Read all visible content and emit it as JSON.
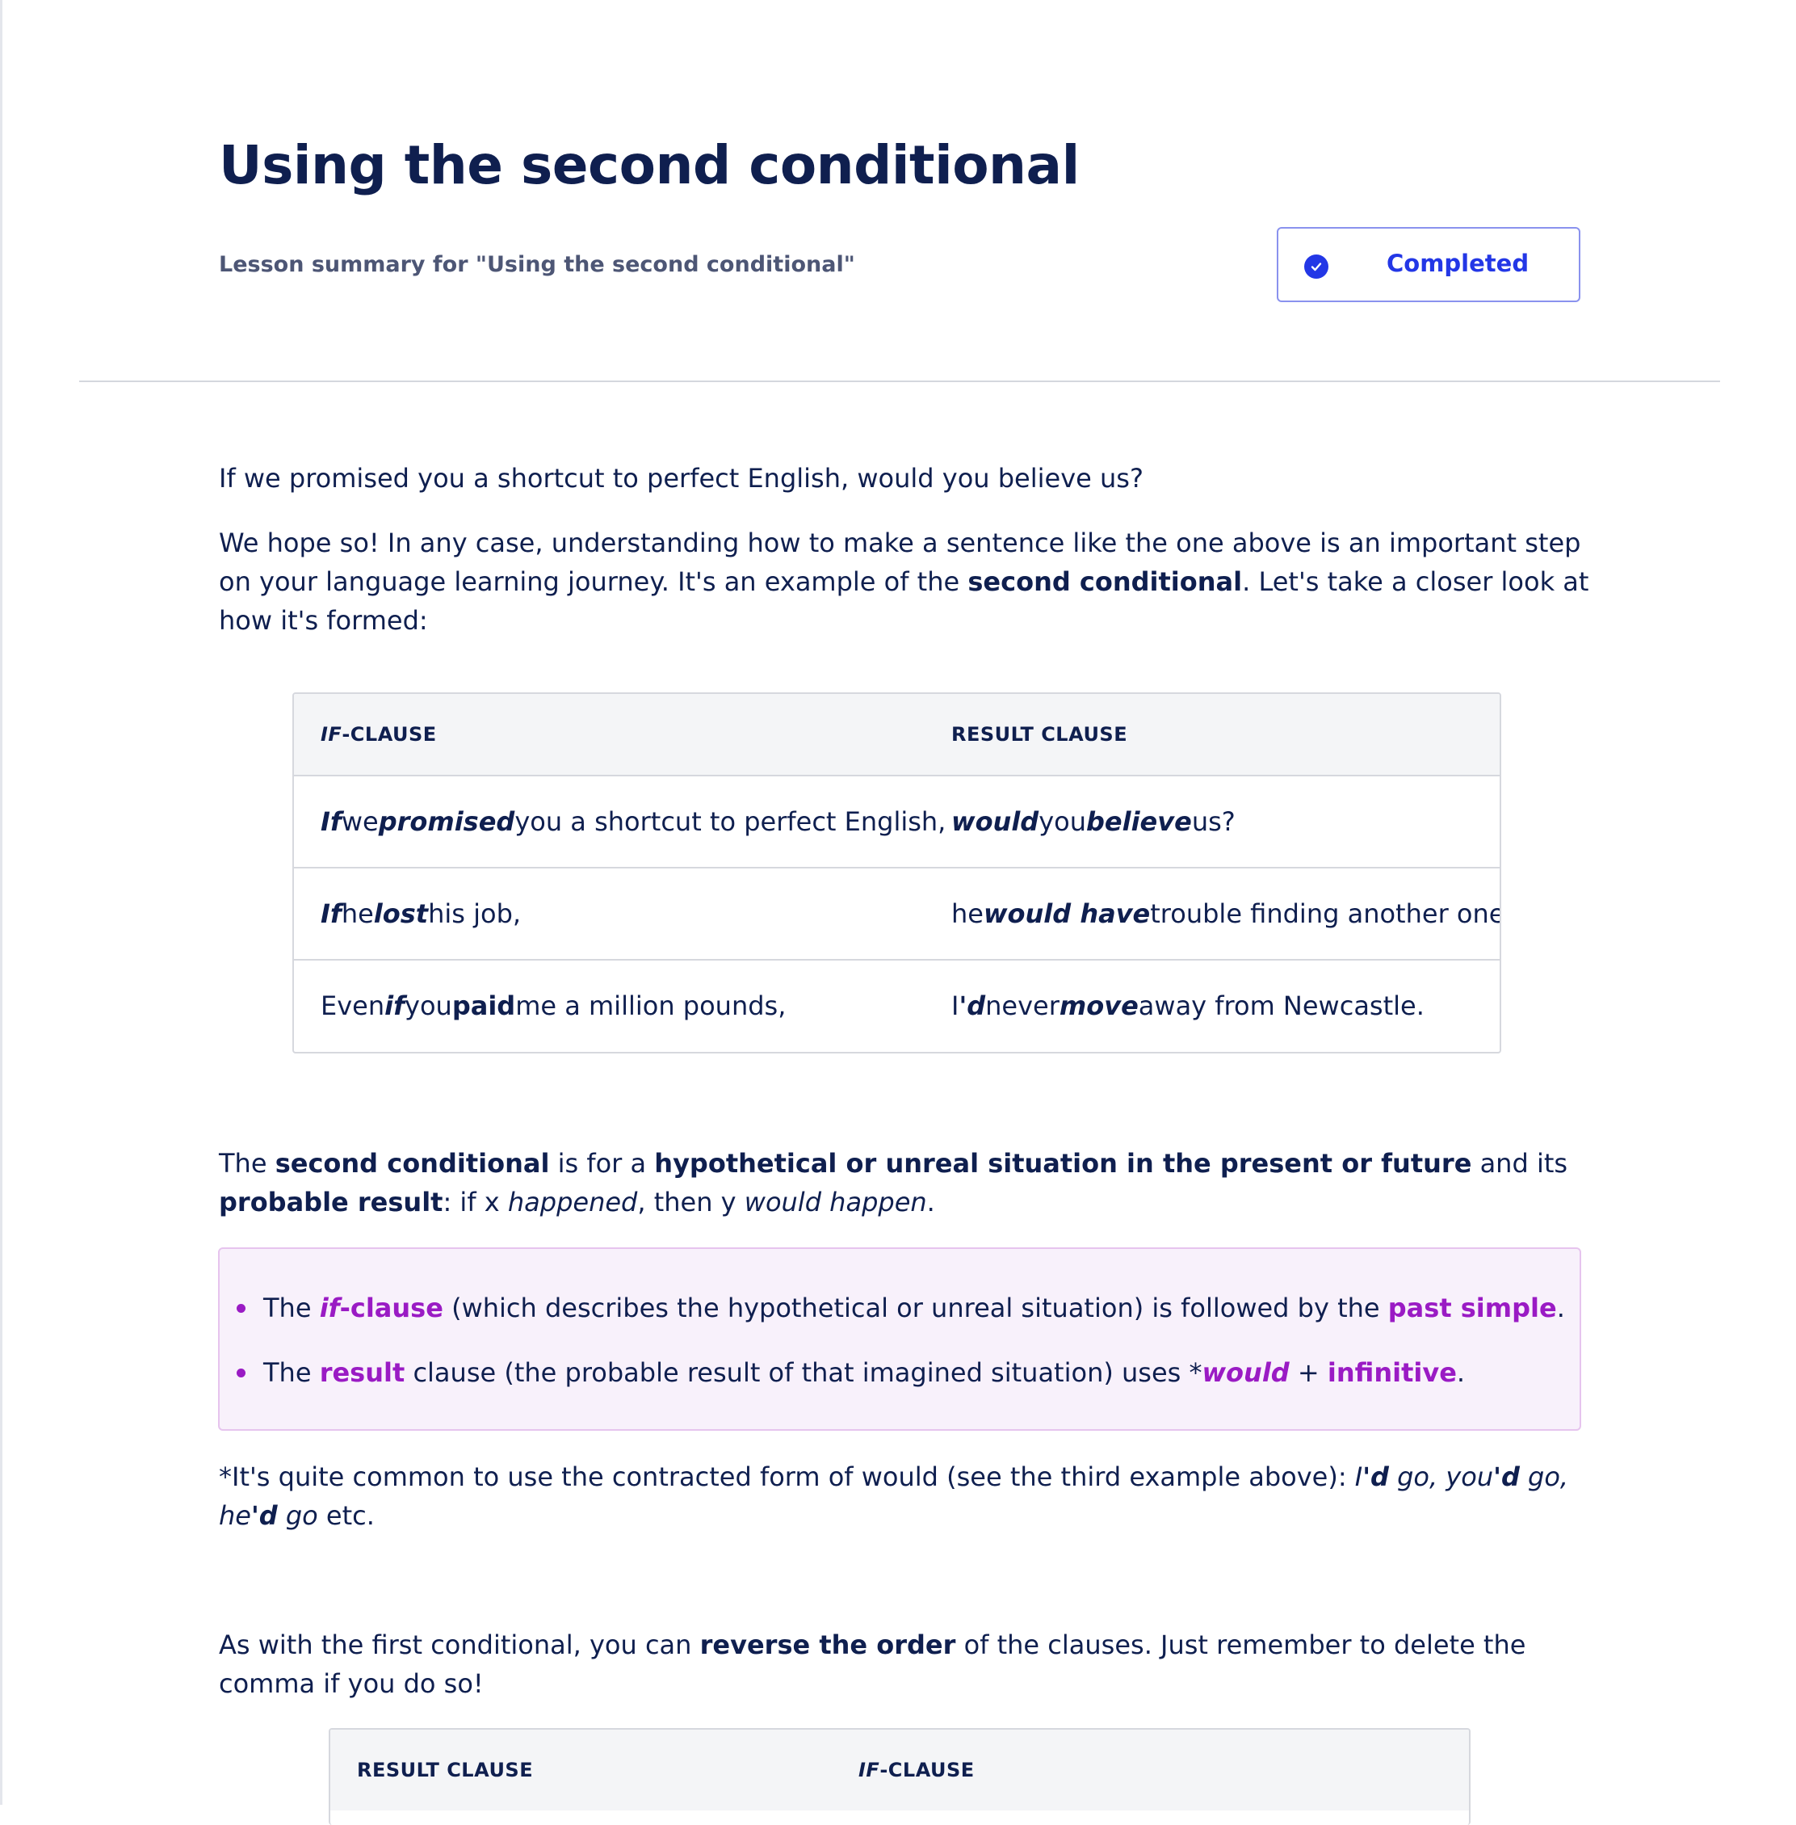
{
  "header": {
    "title": "Using the second conditional",
    "subtitle": "Lesson summary for \"Using the second conditional\"",
    "status_button": "Completed"
  },
  "intro": {
    "p1": "If we promised you a shortcut to perfect English, would you believe us?",
    "p2_a": "We hope so! In any case, understanding how to make a sentence like the one above is an important step on your language learning journey. It's an example of the ",
    "p2_b": "second conditional",
    "p2_c": ". Let's take a closer look at how it's formed:"
  },
  "table1": {
    "headers": {
      "if_prefix": "IF",
      "if_suffix": "-CLAUSE",
      "result": "RESULT CLAUSE"
    },
    "rows": [
      {
        "if_clause": [
          "If",
          " we ",
          "promised",
          " you a shortcut to perfect English,"
        ],
        "result_clause": [
          "would",
          " you ",
          "believe",
          " us?"
        ]
      },
      {
        "if_clause": [
          "If",
          " he ",
          "lost",
          " his job,"
        ],
        "result_clause": [
          "he ",
          "would have",
          " trouble finding another one."
        ]
      },
      {
        "if_clause": [
          "Even ",
          "if",
          " you ",
          "paid",
          " me a million pounds,"
        ],
        "result_clause": [
          "I",
          "'d",
          " never ",
          "move",
          " away from Newcastle."
        ]
      }
    ]
  },
  "explanation": {
    "a": "The ",
    "b": "second conditional",
    "c": " is for a ",
    "d": "hypothetical or unreal situation in the present or future",
    "e": " and its ",
    "f": "probable result",
    "g": ": if x ",
    "h": "happened",
    "i": ", then y ",
    "j": "would happen",
    "k": "."
  },
  "callout": {
    "item1": [
      "The ",
      "if",
      "-clause",
      " (which describes the hypothetical or unreal situation) is followed by the ",
      "past simple",
      "."
    ],
    "item2": [
      "The ",
      "result",
      " clause (the probable result of that imagined situation) uses *",
      "would",
      " + ",
      "infinitive",
      "."
    ]
  },
  "footnote": {
    "a": "*It's quite common to use the contracted form of would (see the third example above): ",
    "b": "I",
    "c": "'d",
    "d": " go, you",
    "e": "'d",
    "f": " go, he",
    "g": "'d",
    "h": " go",
    "i": " etc."
  },
  "reverse": {
    "a": "As with the first conditional, you can ",
    "b": "reverse the order",
    "c": " of the clauses. Just remember to delete the comma if you do so!"
  },
  "table2": {
    "headers": {
      "result": "RESULT CLAUSE",
      "if_prefix": "IF",
      "if_suffix": "-CLAUSE"
    }
  },
  "colors": {
    "text": "#0f1f4f",
    "accent_blue": "#2337e6",
    "accent_purple": "#9a1bc4",
    "callout_bg": "#f8f1fb"
  }
}
